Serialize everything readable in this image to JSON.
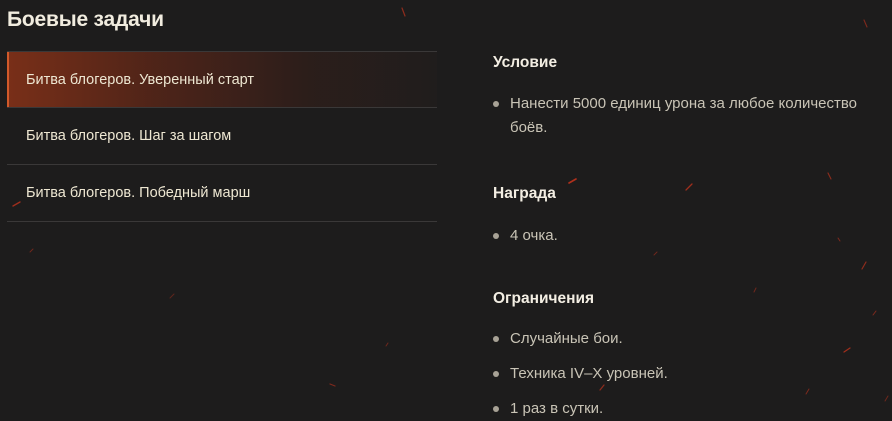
{
  "page": {
    "title": "Боевые задачи"
  },
  "tasks": [
    {
      "label": "Битва блогеров. Уверенный старт",
      "active": true
    },
    {
      "label": "Битва блогеров. Шаг за шагом",
      "active": false
    },
    {
      "label": "Битва блогеров. Победный марш",
      "active": false
    }
  ],
  "details": {
    "condition": {
      "title": "Условие",
      "items": [
        "Нанести 5000 единиц урона за любое количество боёв."
      ]
    },
    "reward": {
      "title": "Награда",
      "items": [
        "4 очка."
      ]
    },
    "limits": {
      "title": "Ограничения",
      "items": [
        "Случайные бои.",
        "Техника IV–X уровней.",
        "1 раз в сутки."
      ]
    }
  },
  "colors": {
    "background": "#1d1c1c",
    "active_accent": "#d1592a",
    "spark": "#c0331c"
  },
  "icons": {
    "bullet": "bullet-dot-icon"
  }
}
